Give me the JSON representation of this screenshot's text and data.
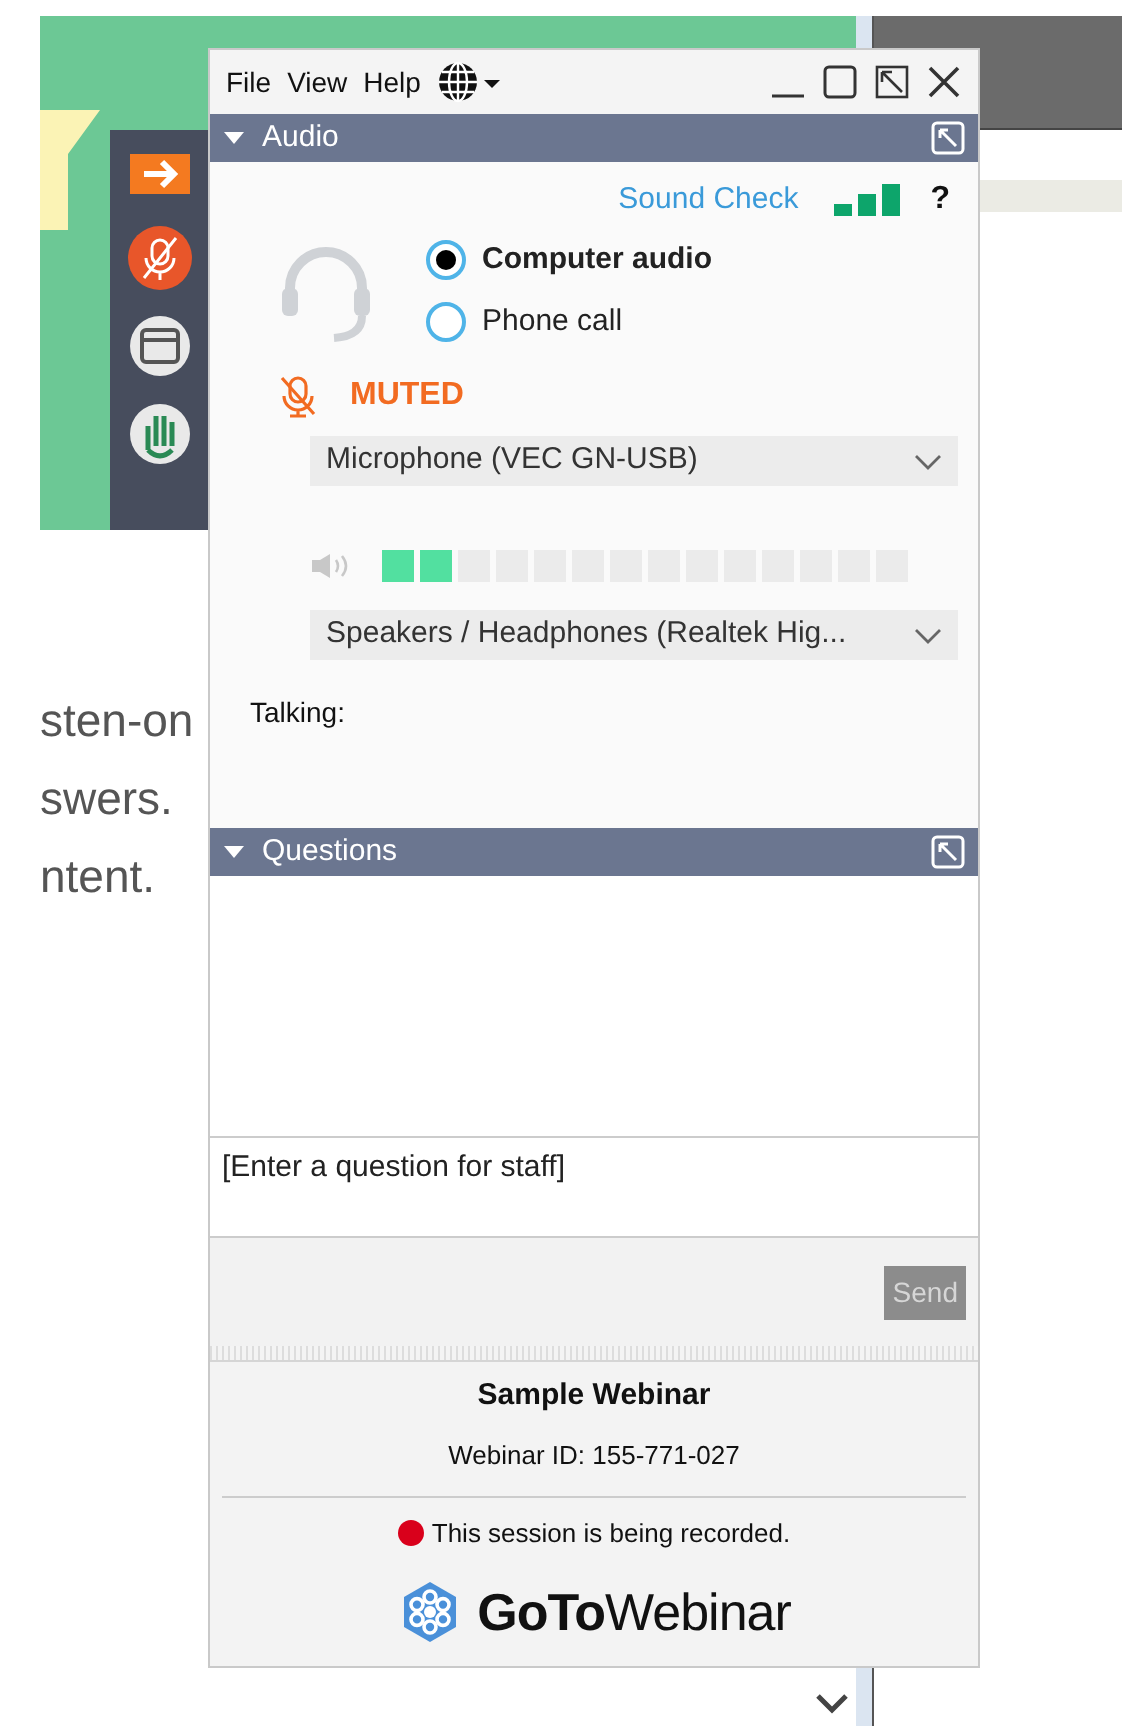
{
  "background": {
    "lines": [
      "sten-on",
      "swers.",
      "ntent."
    ]
  },
  "menu": [
    {
      "label": "File"
    },
    {
      "label": "View"
    },
    {
      "label": "Help"
    }
  ],
  "audio": {
    "title": "Audio",
    "expanded": true,
    "sound_check": "Sound Check",
    "help": "?",
    "options": [
      {
        "label": "Computer audio",
        "selected": true
      },
      {
        "label": "Phone call",
        "selected": false
      }
    ],
    "muted": true,
    "mute_label": "MUTED",
    "microphone": "Microphone (VEC GN-USB)",
    "speaker_meter": {
      "level": 0.143
    },
    "speakers": "Speakers / Headphones (Realtek Hig...",
    "talking": "Talking:"
  },
  "questions": {
    "title": "Questions",
    "expanded": true,
    "placeholder": "[Enter a question for staff]",
    "send": "Send",
    "send_disabled": true
  },
  "footer": {
    "title": "Sample Webinar",
    "webinar_id": "Webinar ID: 155-771-027",
    "recording": "This session is being recorded.",
    "brand": "**GoTo**Webinar"
  }
}
